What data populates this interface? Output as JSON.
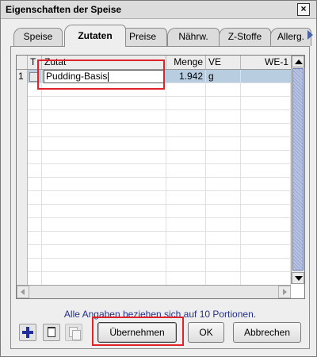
{
  "window": {
    "title": "Eigenschaften der Speise"
  },
  "tabs": [
    {
      "label": "Speise"
    },
    {
      "label": "Zutaten"
    },
    {
      "label": "Preise"
    },
    {
      "label": "Nährw."
    },
    {
      "label": "Z-Stoffe"
    },
    {
      "label": "Allerg."
    }
  ],
  "table": {
    "columns": [
      "T",
      "Zutat",
      "Menge",
      "VE",
      "WE-1"
    ],
    "rows": [
      {
        "num": "1",
        "zutat": "Pudding-Basis",
        "menge": "1.942",
        "ve": "g",
        "we1": ""
      }
    ]
  },
  "info_text": "Alle Angaben beziehen sich auf 10 Portionen.",
  "buttons": {
    "apply": "Übernehmen",
    "ok": "OK",
    "cancel": "Abbrechen"
  }
}
